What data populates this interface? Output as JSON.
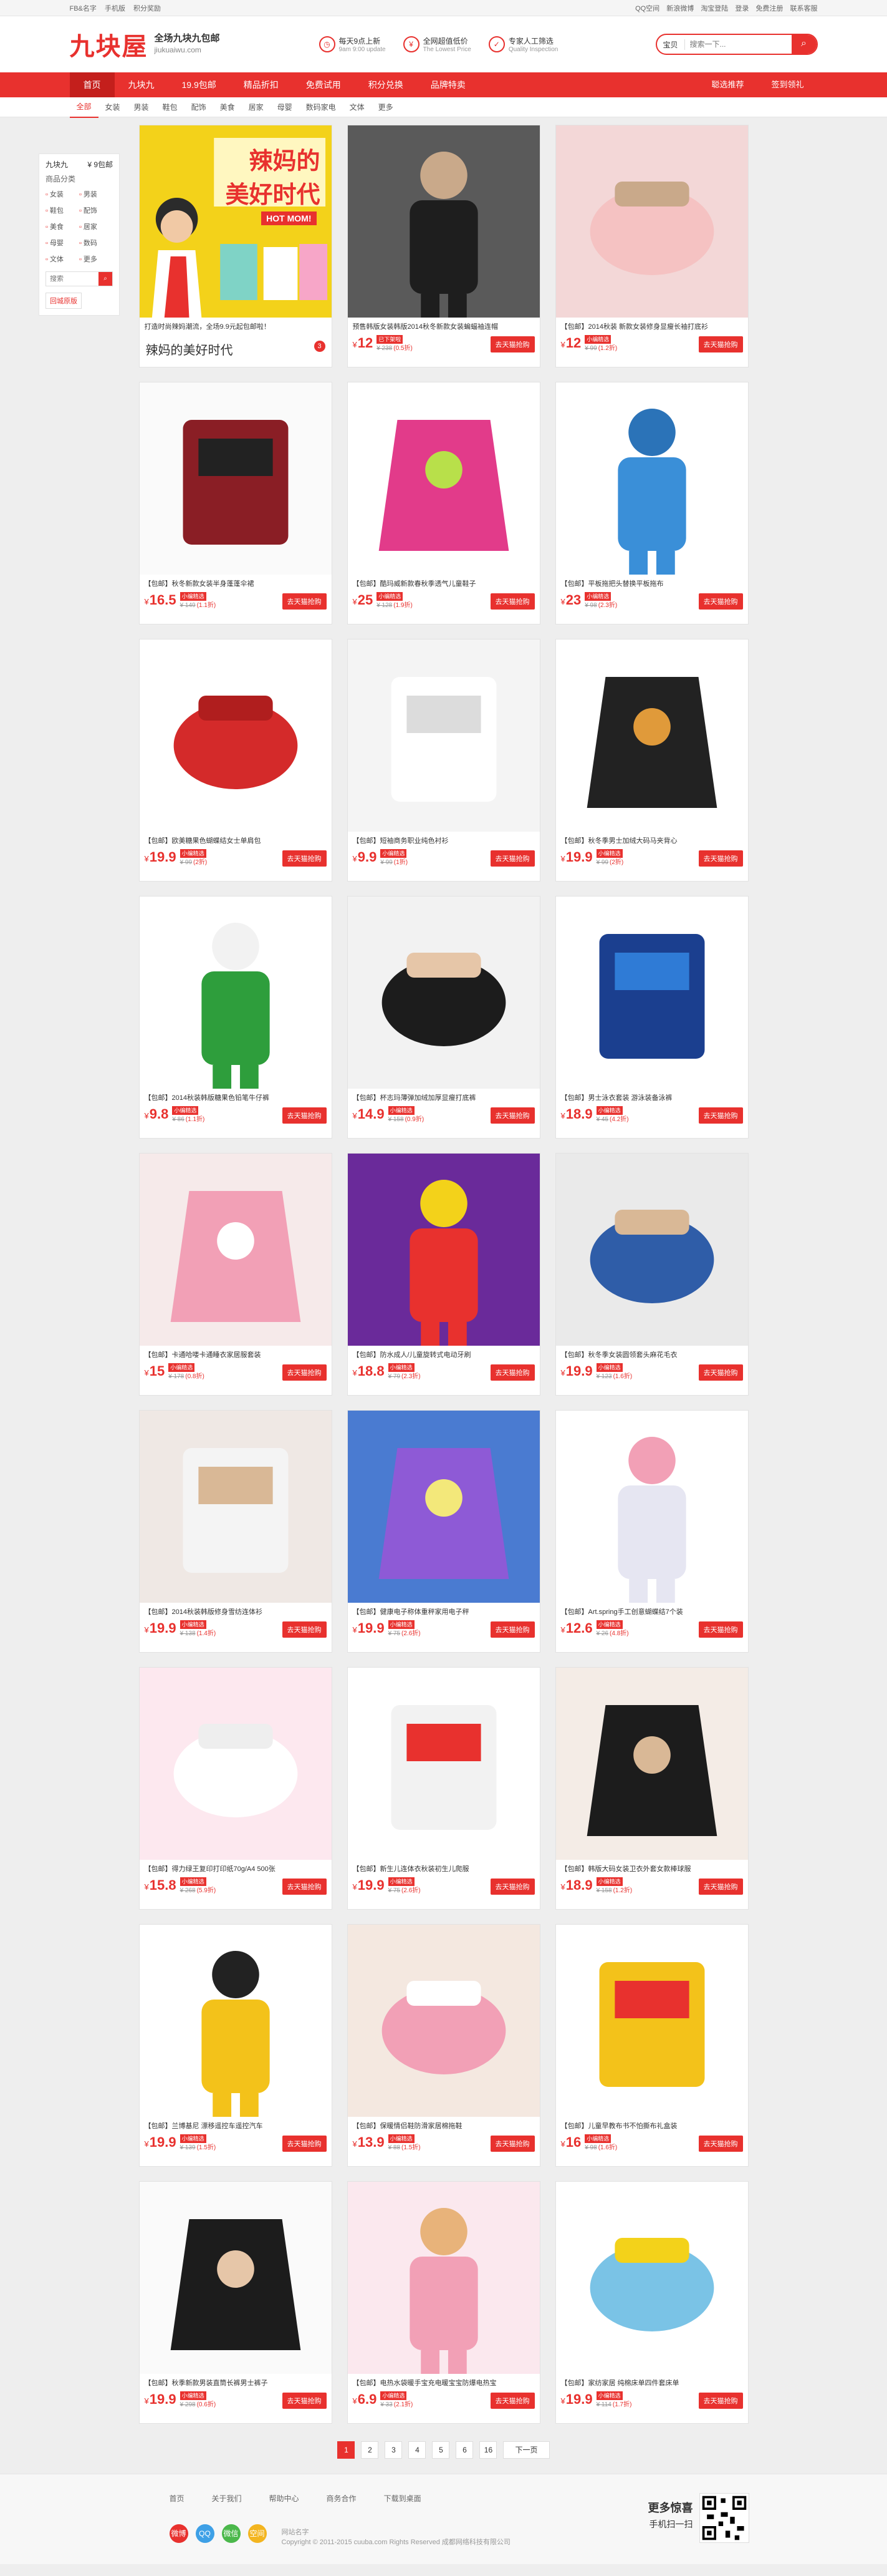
{
  "topbar": {
    "left": [
      "FB&名字",
      "手机版",
      "积分奖励"
    ],
    "right": [
      "QQ空间",
      "新浪微博",
      "淘宝登陆",
      "登录",
      "免费注册",
      "联系客服"
    ]
  },
  "header": {
    "logo_main": "九块屋",
    "logo_sub1": "全场九块九包邮",
    "logo_sub2": "jiukuaiwu.com",
    "promises": [
      {
        "t1": "每天9点上新",
        "t2": "9am 9:00 update"
      },
      {
        "t1": "全网超值低价",
        "t2": "The Lowest Price"
      },
      {
        "t1": "专家人工筛选",
        "t2": "Quality Inspection"
      }
    ],
    "search_scope": "宝贝",
    "search_placeholder": "搜索一下..."
  },
  "nav": {
    "items": [
      "首页",
      "九块九",
      "19.9包邮",
      "精品折扣",
      "免费试用",
      "积分兑换",
      "品牌特卖"
    ],
    "right": [
      "聪选推荐",
      "签到领礼"
    ]
  },
  "categories": [
    "全部",
    "女装",
    "男装",
    "鞋包",
    "配饰",
    "美食",
    "居家",
    "母婴",
    "数码家电",
    "文体",
    "更多"
  ],
  "side": {
    "h_left": "九块九",
    "h_right": "¥ 9包邮",
    "h2": "商品分类",
    "items": [
      "女装",
      "男装",
      "鞋包",
      "配饰",
      "美食",
      "居家",
      "母婴",
      "数码",
      "文体",
      "更多"
    ],
    "search_placeholder": "搜索",
    "retro": "回城原版"
  },
  "promo": {
    "banner_top": "辣妈的",
    "banner_mid": "美好时代",
    "banner_en": "HOT MOM!",
    "text": "打造时尚辣妈潮流，全场9.9元起包邮啦！",
    "title": "辣妈的美好时代",
    "badge": "3"
  },
  "products": [
    {
      "title": "预售韩版女装韩版2014秋冬新款女装蝙蝠袖连帽",
      "price": "12",
      "tag": "已下架啦",
      "orig": "¥ 238",
      "disc": "(0.5折)",
      "buy": "去天猫抢购"
    },
    {
      "title": "【包邮】2014秋装 新款女装修身显瘦长袖打底衫",
      "price": "12",
      "tag": "小编精选",
      "orig": "¥ 99",
      "disc": "(1.2折)",
      "buy": "去天猫抢购"
    },
    {
      "title": "【包邮】秋冬新款女装半身蓬蓬伞裙",
      "price": "16.5",
      "tag": "小编精选",
      "orig": "¥ 149",
      "disc": "(1.1折)",
      "buy": "去天猫抢购"
    },
    {
      "title": "【包邮】酷玛威新款春秋季透气儿童鞋子",
      "price": "25",
      "tag": "小编精选",
      "orig": "¥ 128",
      "disc": "(1.9折)",
      "buy": "去天猫抢购"
    },
    {
      "title": "【包邮】平板拖把头替换平板拖布",
      "price": "23",
      "tag": "小编精选",
      "orig": "¥ 98",
      "disc": "(2.3折)",
      "buy": "去天猫抢购"
    },
    {
      "title": "【包邮】欧美糖果色蝴蝶结女士单肩包",
      "price": "19.9",
      "tag": "小编精选",
      "orig": "¥ 99",
      "disc": "(2折)",
      "buy": "去天猫抢购"
    },
    {
      "title": "【包邮】短袖商务职业纯色衬衫",
      "price": "9.9",
      "tag": "小编精选",
      "orig": "¥ 99",
      "disc": "(1折)",
      "buy": "去天猫抢购"
    },
    {
      "title": "【包邮】秋冬季男士加绒大码马夹背心",
      "price": "19.9",
      "tag": "小编精选",
      "orig": "¥ 99",
      "disc": "(2折)",
      "buy": "去天猫抢购"
    },
    {
      "title": "【包邮】2014秋装韩版糖果色铅笔牛仔裤",
      "price": "9.8",
      "tag": "小编精选",
      "orig": "¥ 86",
      "disc": "(1.1折)",
      "buy": "去天猫抢购"
    },
    {
      "title": "【包邮】杯志玛薄弹加绒加厚显瘦打底裤",
      "price": "14.9",
      "tag": "小编精选",
      "orig": "¥ 158",
      "disc": "(0.9折)",
      "buy": "去天猫抢购"
    },
    {
      "title": "【包邮】男士泳衣套装 游泳装备泳裤",
      "price": "18.9",
      "tag": "小编精选",
      "orig": "¥ 45",
      "disc": "(4.2折)",
      "buy": "去天猫抢购"
    },
    {
      "title": "【包邮】卡通哈喽卡通睡衣家居服套装",
      "price": "15",
      "tag": "小编精选",
      "orig": "¥ 178",
      "disc": "(0.8折)",
      "buy": "去天猫抢购"
    },
    {
      "title": "【包邮】防水成人/儿童旋转式电动牙刷",
      "price": "18.8",
      "tag": "小编精选",
      "orig": "¥ 79",
      "disc": "(2.3折)",
      "buy": "去天猫抢购"
    },
    {
      "title": "【包邮】秋冬季女装圆领套头麻花毛衣",
      "price": "19.9",
      "tag": "小编精选",
      "orig": "¥ 123",
      "disc": "(1.6折)",
      "buy": "去天猫抢购"
    },
    {
      "title": "【包邮】2014秋装韩版修身雪纺连体衫",
      "price": "19.9",
      "tag": "小编精选",
      "orig": "¥ 138",
      "disc": "(1.4折)",
      "buy": "去天猫抢购"
    },
    {
      "title": "【包邮】健康电子称体重秤家用电子秤",
      "price": "19.9",
      "tag": "小编精选",
      "orig": "¥ 75",
      "disc": "(2.6折)",
      "buy": "去天猫抢购"
    },
    {
      "title": "【包邮】Art.spring手工创意蝴蝶结7个装",
      "price": "12.6",
      "tag": "小编精选",
      "orig": "¥ 26",
      "disc": "(4.8折)",
      "buy": "去天猫抢购"
    },
    {
      "title": "【包邮】得力绿王复印打印纸70g/A4 500张",
      "price": "15.8",
      "tag": "小编精选",
      "orig": "¥ 268",
      "disc": "(5.9折)",
      "buy": "去天猫抢购"
    },
    {
      "title": "【包邮】新生儿连体衣秋装初生儿爬服",
      "price": "19.9",
      "tag": "小编精选",
      "orig": "¥ 75",
      "disc": "(2.6折)",
      "buy": "去天猫抢购"
    },
    {
      "title": "【包邮】韩版大码女装卫衣外套女款棒球服",
      "price": "18.9",
      "tag": "小编精选",
      "orig": "¥ 158",
      "disc": "(1.2折)",
      "buy": "去天猫抢购"
    },
    {
      "title": "【包邮】兰博基尼 漂移遥控车遥控汽车",
      "price": "19.9",
      "tag": "小编精选",
      "orig": "¥ 139",
      "disc": "(1.5折)",
      "buy": "去天猫抢购"
    },
    {
      "title": "【包邮】保暖情侣鞋防滑家居棉拖鞋",
      "price": "13.9",
      "tag": "小编精选",
      "orig": "¥ 88",
      "disc": "(1.5折)",
      "buy": "去天猫抢购"
    },
    {
      "title": "【包邮】儿童早教布书不怕撕布礼盒装",
      "price": "16",
      "tag": "小编精选",
      "orig": "¥ 98",
      "disc": "(1.6折)",
      "buy": "去天猫抢购"
    },
    {
      "title": "【包邮】秋季新款男装直筒长裤男士裤子",
      "price": "19.9",
      "tag": "小编精选",
      "orig": "¥ 298",
      "disc": "(0.6折)",
      "buy": "去天猫抢购"
    },
    {
      "title": "【包邮】电热水袋暖手宝充电暖宝宝防爆电热宝",
      "price": "6.9",
      "tag": "小编精选",
      "orig": "¥ 33",
      "disc": "(2.1折)",
      "buy": "去天猫抢购"
    },
    {
      "title": "【包邮】家纺家居 纯棉床单四件套床单",
      "price": "19.9",
      "tag": "小编精选",
      "orig": "¥ 114",
      "disc": "(1.7折)",
      "buy": "去天猫抢购"
    }
  ],
  "pager": [
    "1",
    "2",
    "3",
    "4",
    "5",
    "6",
    "16",
    "下一页"
  ],
  "footer": {
    "links": [
      "首页",
      "关于我们",
      "帮助中心",
      "商务合作",
      "下载到桌面"
    ],
    "social": [
      "微博",
      "QQ",
      "微信",
      "空间"
    ],
    "copy1": "网站名字",
    "copy2": "Copyright © 2011-2015 cuuba.com Rights Reserved 成都网络科技有限公司",
    "qr1": "更多惊喜",
    "qr2": "手机扫一扫"
  },
  "colors": {
    "accent": "#e8312e",
    "accent_dark": "#c41f1c",
    "page_bg": "#eeeeee"
  }
}
